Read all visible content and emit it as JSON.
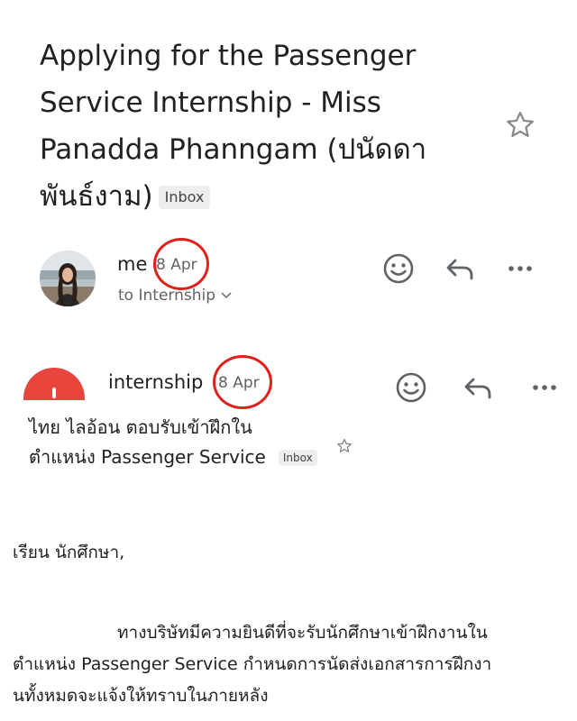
{
  "email1": {
    "subject": "Applying for the Passenger Service Internship - Miss Panadda Phanngam (ปนัดดา พันธ์งาม)",
    "label": "Inbox",
    "sender": "me",
    "date": "8 Apr",
    "recipient_prefix": "to",
    "recipient": "Internship"
  },
  "email2": {
    "sender": "internship",
    "date": "8 Apr",
    "subject_line1": "ไทย ไลอ้อน ตอบรับเข้าฝึกใน",
    "subject_line2": "ตำแหน่ง Passenger Service",
    "label": "Inbox"
  },
  "body": {
    "greeting": "เรียน นักศึกษา,",
    "para_line1": "ทางบริษัทมีความยินดีที่จะรับนักศึกษาเข้าฝึกงานใน",
    "para_line2": "ตำแหน่ง Passenger Service กำหนดการนัดส่งเอกสารการฝึกงา",
    "para_line3": "นทั้งหมดจะแจ้งให้ทราบในภายหลัง"
  },
  "icons": [
    "star-outline-icon",
    "emoji-icon",
    "reply-icon",
    "more-icon",
    "chevron-down-icon"
  ],
  "colors": {
    "annotation_red": "#e0201b",
    "avatar_red": "#e8453c",
    "icon_gray": "#5f6368"
  }
}
